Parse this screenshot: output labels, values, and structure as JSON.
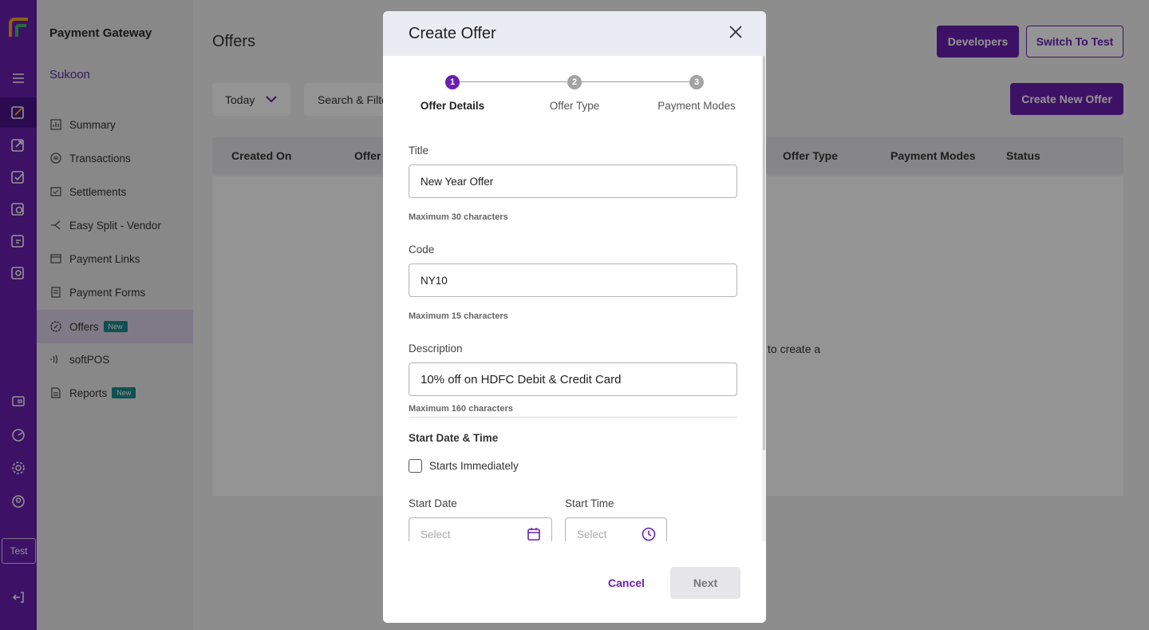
{
  "app": {
    "brand": "Payment Gateway",
    "merchant": "Sukoon",
    "env_badge": "Test",
    "accent_color": "#6a1fb0"
  },
  "rail": {
    "icons": [
      "brand-logo-icon",
      "menu-icon",
      "payment-gateway-icon",
      "export-icon",
      "checklist-icon",
      "refresh-doc-icon",
      "document-icon",
      "user-doc-icon",
      "wallet-icon",
      "analytics-icon",
      "settings-icon",
      "profile-icon",
      "logout-icon"
    ]
  },
  "sidenav": {
    "items": [
      {
        "label": "Summary",
        "icon": "bar-chart-icon",
        "badge": ""
      },
      {
        "label": "Transactions",
        "icon": "transactions-icon",
        "badge": ""
      },
      {
        "label": "Settlements",
        "icon": "settlements-icon",
        "badge": ""
      },
      {
        "label": "Easy Split - Vendor",
        "icon": "split-icon",
        "badge": ""
      },
      {
        "label": "Payment Links",
        "icon": "link-icon",
        "badge": ""
      },
      {
        "label": "Payment Forms",
        "icon": "form-icon",
        "badge": ""
      },
      {
        "label": "Offers",
        "icon": "offers-icon",
        "badge": "New"
      },
      {
        "label": "softPOS",
        "icon": "contactless-icon",
        "badge": ""
      },
      {
        "label": "Reports",
        "icon": "report-icon",
        "badge": "New"
      }
    ]
  },
  "header": {
    "title": "Offers",
    "developers_label": "Developers",
    "switch_label": "Switch To Test"
  },
  "toolbar": {
    "date_filter": "Today",
    "search_label": "Search & Filte",
    "create_label": "Create New Offer"
  },
  "table": {
    "columns": [
      "Created On",
      "Offer",
      "Offer Type",
      "Payment Modes",
      "Status"
    ],
    "empty_message": "to create a"
  },
  "modal": {
    "title": "Create Offer",
    "steps": [
      {
        "number": "1",
        "label": "Offer Details"
      },
      {
        "number": "2",
        "label": "Offer Type"
      },
      {
        "number": "3",
        "label": "Payment Modes"
      }
    ],
    "fields": {
      "title": {
        "label": "Title",
        "value": "New Year Offer",
        "hint": "Maximum 30 characters"
      },
      "code": {
        "label": "Code",
        "value": "NY10",
        "hint": "Maximum 15 characters"
      },
      "description": {
        "label": "Description",
        "value": "10% off on HDFC Debit & Credit Card",
        "hint": "Maximum 160 characters"
      }
    },
    "start_section": {
      "title": "Start Date & Time",
      "checkbox_label": "Starts Immediately",
      "date_label": "Start Date",
      "date_placeholder": "Select",
      "time_label": "Start Time",
      "time_placeholder": "Select"
    },
    "cancel_label": "Cancel",
    "next_label": "Next"
  }
}
